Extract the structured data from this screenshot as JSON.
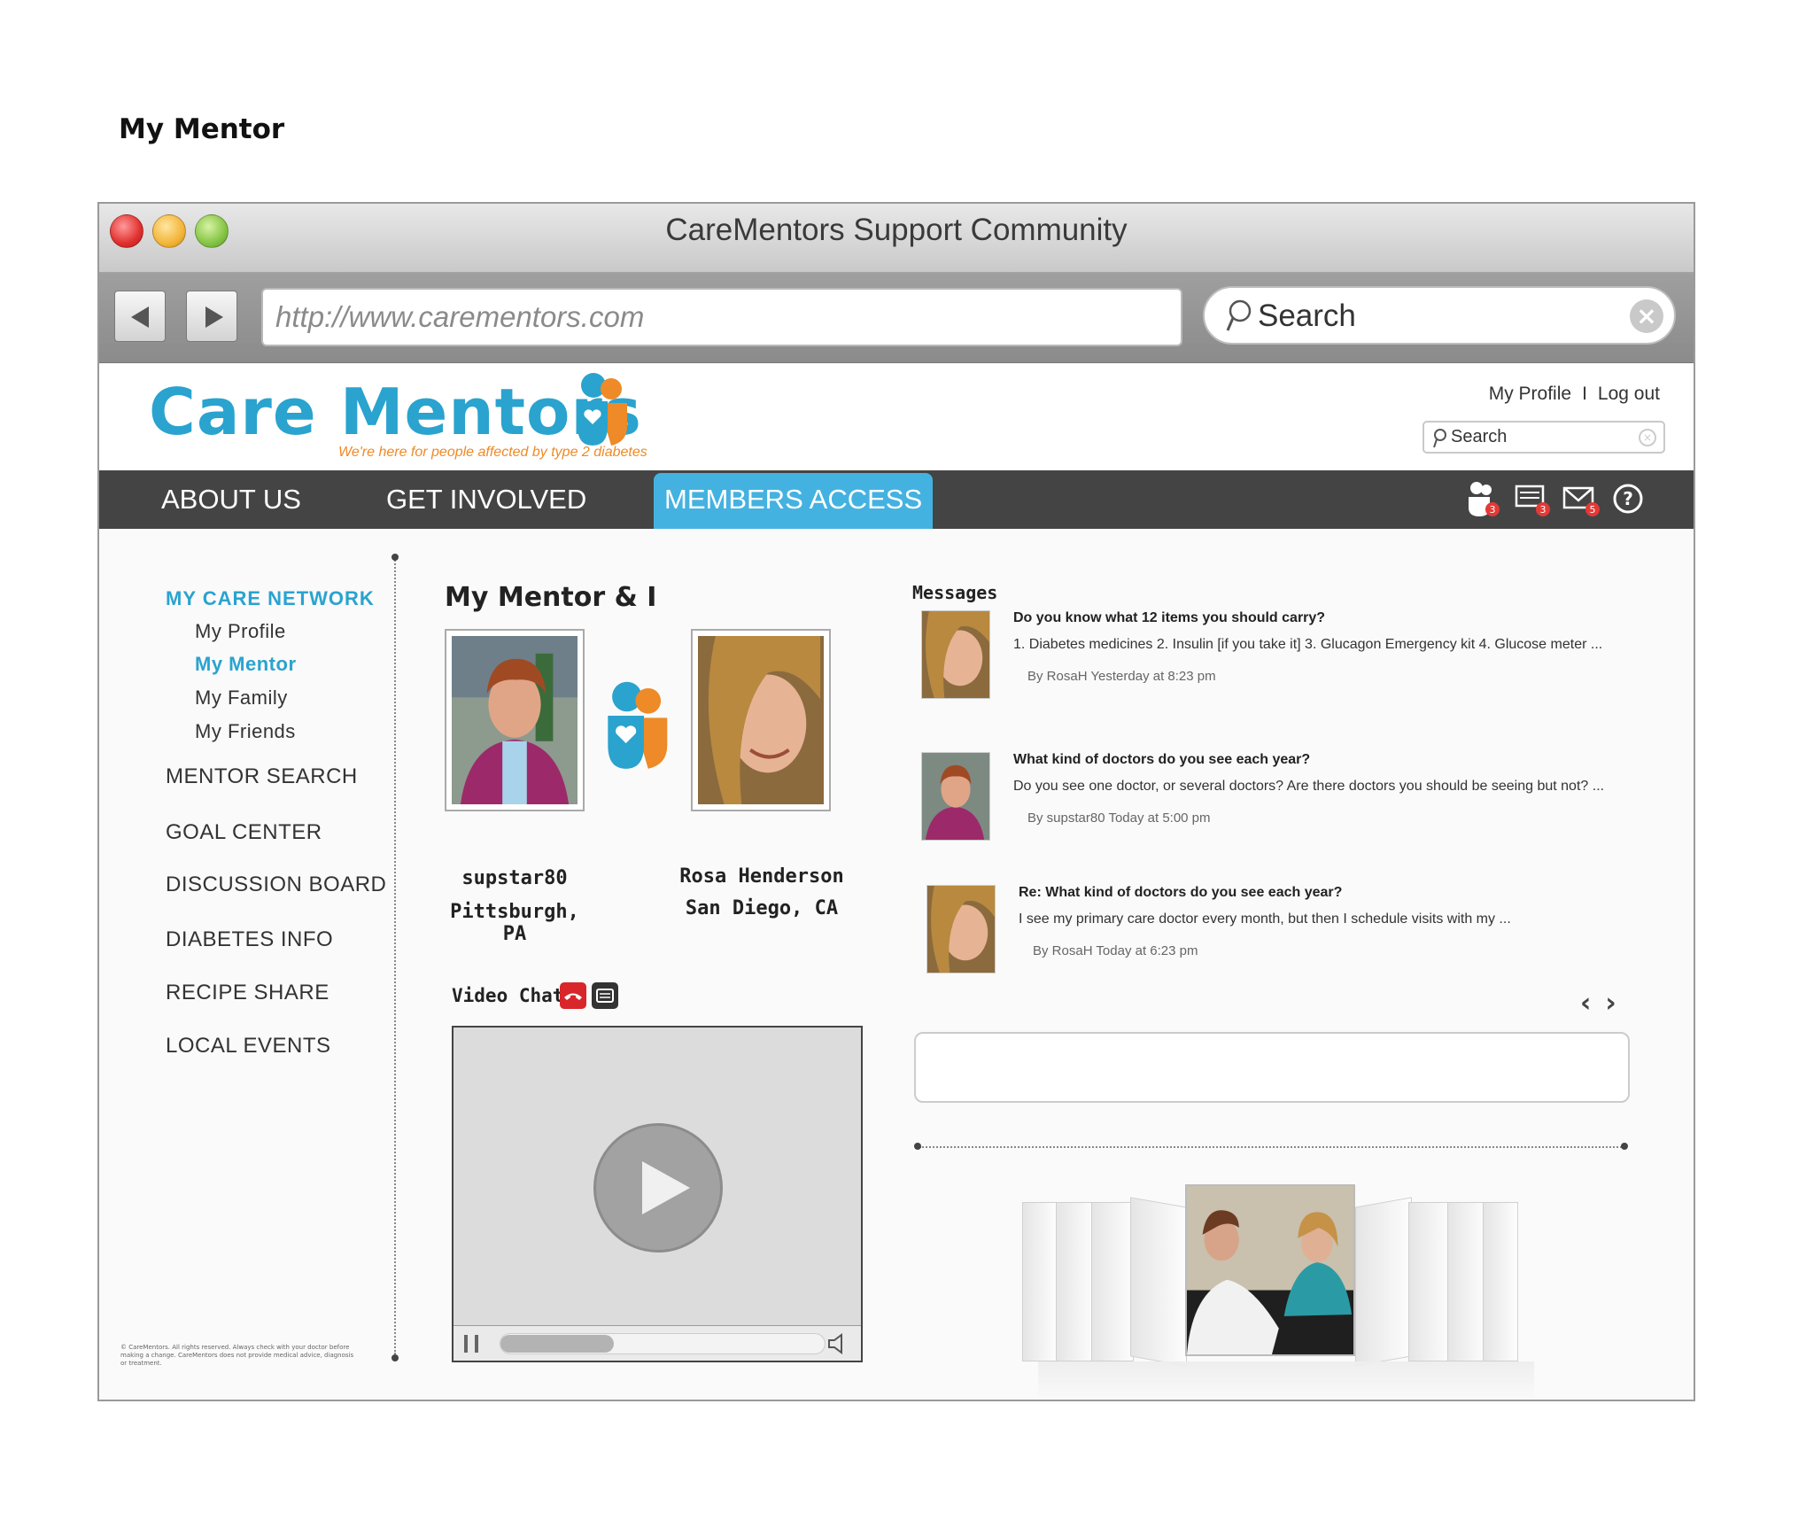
{
  "page_heading": "My Mentor",
  "window": {
    "title": "CareMentors Support Community",
    "url": "http://www.carementors.com",
    "search_placeholder": "Search"
  },
  "site": {
    "logo": "Care Mentors",
    "tagline": "We're here for people affected by type 2 diabetes",
    "header_links": {
      "profile": "My Profile",
      "separator": "I",
      "logout": "Log out"
    },
    "search_placeholder": "Search",
    "brand_color": "#2aa3cf",
    "accent_color": "#ee8a27"
  },
  "nav": {
    "items": [
      {
        "label": "ABOUT US"
      },
      {
        "label": "GET INVOLVED"
      },
      {
        "label": "MEMBERS ACCESS",
        "active": true
      }
    ],
    "icons": [
      {
        "name": "mentor-notifications-icon",
        "badge": "3"
      },
      {
        "name": "messages-icon",
        "badge": "3"
      },
      {
        "name": "mail-icon",
        "badge": "5"
      },
      {
        "name": "help-icon"
      }
    ]
  },
  "sidebar": {
    "section_title": "MY CARE NETWORK",
    "sub_items": [
      "My  Profile",
      "My Mentor",
      "My Family",
      "My Friends"
    ],
    "items": [
      "MENTOR SEARCH",
      "GOAL CENTER",
      "DISCUSSION BOARD",
      "DIABETES INFO",
      "RECIPE SHARE",
      "LOCAL EVENTS"
    ],
    "fine_print": "© CareMentors. All rights reserved. Always check with your doctor before making a change. CareMentors does not provide medical advice, diagnosis or treatment."
  },
  "mentor": {
    "title": "My Mentor & I",
    "me": {
      "name": "supstar80",
      "location": "Pittsburgh, PA"
    },
    "mentor": {
      "name": "Rosa Henderson",
      "location": "San Diego, CA"
    }
  },
  "video_chat": {
    "label": "Video Chat",
    "progress": 0.35
  },
  "messages": {
    "title": "Messages",
    "items": [
      {
        "subject": "Do you know what 12 items you should carry?",
        "body": "1. Diabetes medicines 2. Insulin [if you take it] 3. Glucagon Emergency kit 4. Glucose meter ...",
        "meta": "By RosaH Yesterday at 8:23 pm",
        "avatar": "rosa"
      },
      {
        "subject": "What kind of doctors do you see each year?",
        "body": "Do you see one doctor, or several doctors? Are there doctors you should be seeing but not? ...",
        "meta": "By supstar80 Today at 5:00 pm",
        "avatar": "supstar"
      },
      {
        "subject": "Re: What kind of doctors do you see each year?",
        "body": "I see my primary care doctor every month, but then I schedule visits with my  ...",
        "meta": "By RosaH Today at 6:23 pm",
        "avatar": "rosa"
      }
    ],
    "pager": {
      "prev": "‹",
      "next": "›"
    }
  }
}
